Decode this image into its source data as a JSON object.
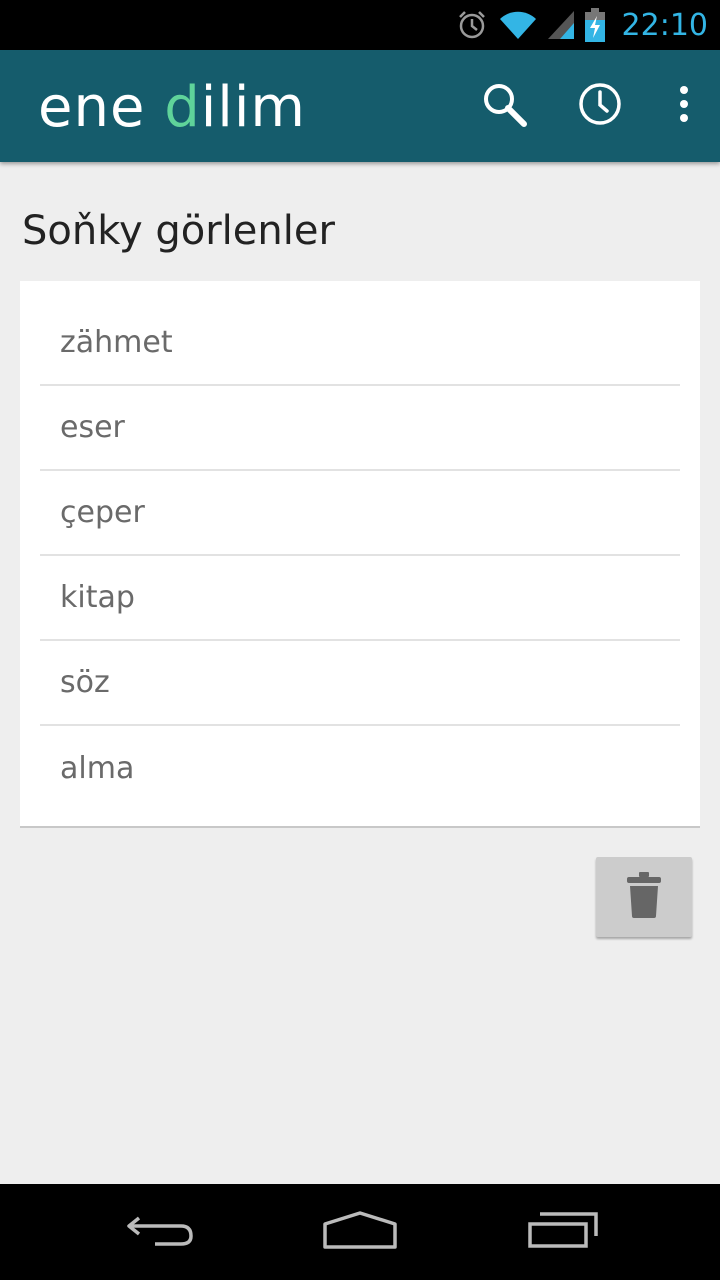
{
  "status_bar": {
    "time": "22:10",
    "icons": [
      "alarm-icon",
      "wifi-icon",
      "signal-icon",
      "battery-charging-icon"
    ],
    "time_color": "#33b5e5"
  },
  "app_bar": {
    "logo_part1": "ene ",
    "logo_accent_letter": "d",
    "logo_part2": "ilim",
    "background_color": "#155c6c",
    "accent_color": "#5fd39a",
    "actions": [
      "search-icon",
      "history-icon",
      "overflow-menu-icon"
    ]
  },
  "recent": {
    "title": "Soňky görlenler",
    "items": [
      "zähmet",
      "eser",
      "çeper",
      "kitap",
      "söz",
      "alma"
    ]
  },
  "clear_button": {
    "icon": "trash-icon"
  },
  "nav_bar": {
    "buttons": [
      "back-icon",
      "home-icon",
      "recent-apps-icon"
    ]
  }
}
